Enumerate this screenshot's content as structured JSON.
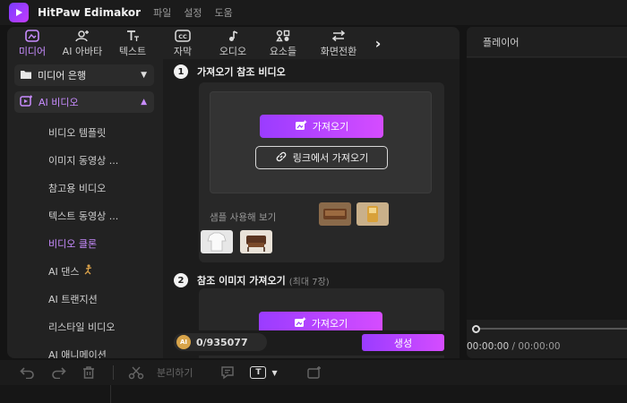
{
  "app": {
    "title": "HitPaw Edimakor",
    "menu": [
      "파일",
      "설정",
      "도움"
    ]
  },
  "tabs": [
    {
      "label": "미디어",
      "icon": "media-icon",
      "active": true
    },
    {
      "label": "AI 아바타",
      "icon": "avatar-icon",
      "active": false
    },
    {
      "label": "텍스트",
      "icon": "text-icon",
      "active": false
    },
    {
      "label": "자막",
      "icon": "caption-icon",
      "active": false
    },
    {
      "label": "오디오",
      "icon": "music-icon",
      "active": false
    },
    {
      "label": "요소들",
      "icon": "elements-icon",
      "active": false
    },
    {
      "label": "화면전환",
      "icon": "transition-icon",
      "active": false
    }
  ],
  "sidebar": {
    "media_bank": "미디어 은행",
    "ai_video": "AI 비디오",
    "items": [
      {
        "label": "비디오 템플릿"
      },
      {
        "label": "이미지 동영상 ..."
      },
      {
        "label": "참고용 비디오"
      },
      {
        "label": "텍스트 동영상 ..."
      },
      {
        "label": "비디오 클론"
      },
      {
        "label": "AI 댄스"
      },
      {
        "label": "AI 트랜지션"
      },
      {
        "label": "리스타일 비디오"
      },
      {
        "label": "AI 애니메이션"
      }
    ]
  },
  "center": {
    "step1": {
      "num": "1",
      "title": "가져오기 참조 비디오"
    },
    "import_button": "가져오기",
    "link_import_button": "링크에서 가져오기",
    "sample_label": "샘플 사용해 보기",
    "step2": {
      "num": "2",
      "title": "참조 이미지 가져오기",
      "sub": "(최대 7장)"
    },
    "import_button2": "가져오기"
  },
  "bottom": {
    "credits": "0/935077",
    "coin": "AI",
    "generate_button": "생성"
  },
  "player": {
    "title": "플레이어",
    "time_current": "00:00:00",
    "time_sep": " / ",
    "time_total": "00:00:00"
  },
  "toolbar": {
    "split_label": "분리하기",
    "text_badge": "T"
  },
  "colors": {
    "accent": "#c88cff",
    "gradient_start": "#9a3cff",
    "gradient_end": "#d54cff"
  }
}
